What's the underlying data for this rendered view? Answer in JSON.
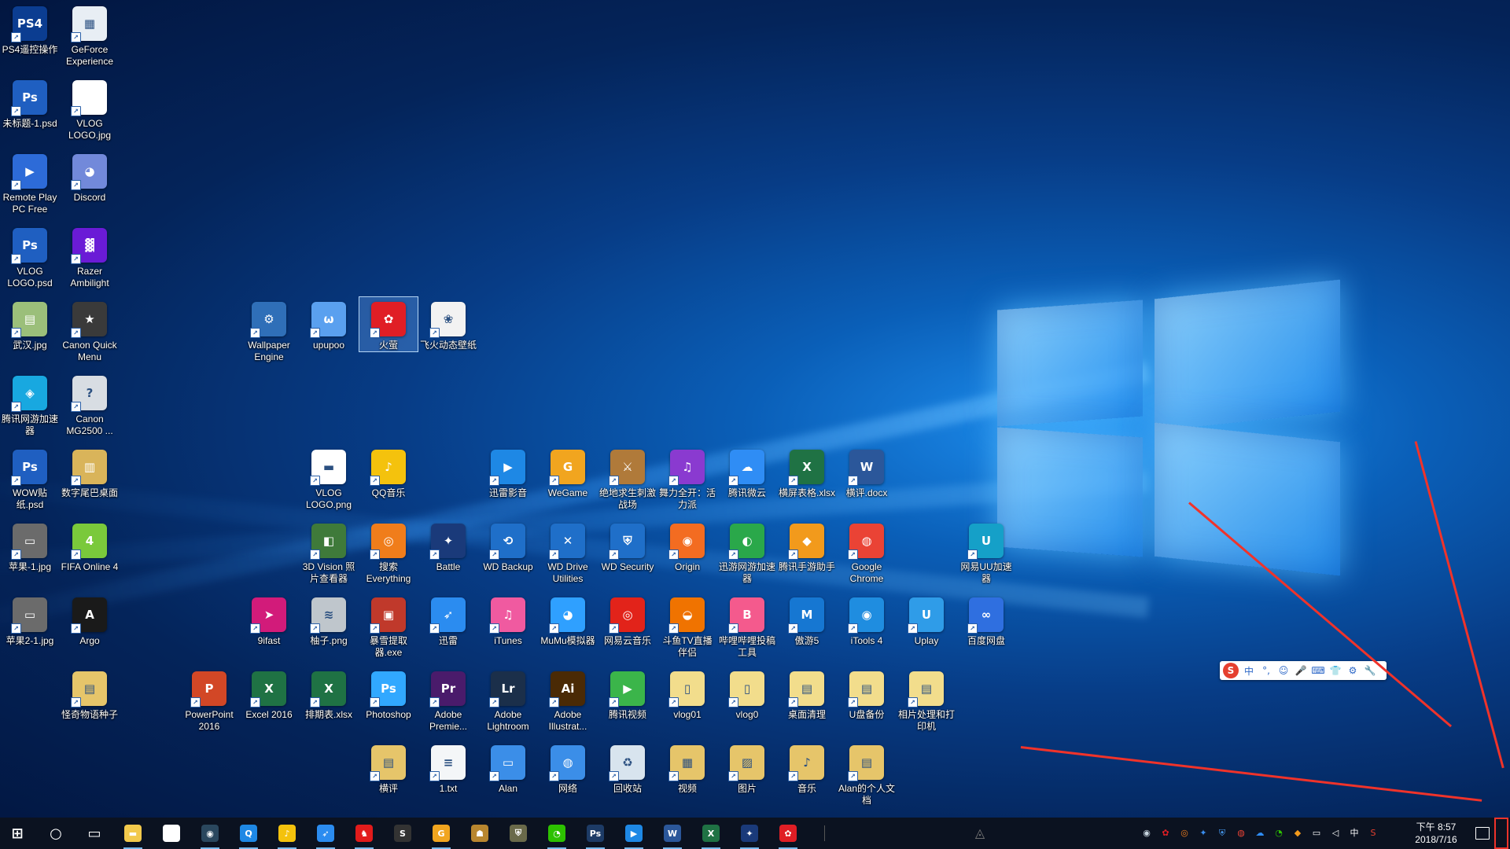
{
  "desktop": {
    "icons": [
      {
        "id": "ps4",
        "label": "PS4遥控操作",
        "glyph": "PS4",
        "color": "#0b3d91",
        "col": 0,
        "row": 0
      },
      {
        "id": "geforce",
        "label": "GeForce Experience",
        "glyph": "▦",
        "color": "#e8eef4",
        "col": 1,
        "row": 0
      },
      {
        "id": "untitled-psd",
        "label": "未标题-1.psd",
        "glyph": "Ps",
        "color": "#1f5fc1",
        "col": 0,
        "row": 1
      },
      {
        "id": "vlog-logo-jpg",
        "label": "VLOG LOGO.jpg",
        "glyph": "",
        "color": "#ffffff",
        "col": 1,
        "row": 1
      },
      {
        "id": "remote-play",
        "label": "Remote Play PC Free",
        "glyph": "▶",
        "color": "#2d6bd8",
        "col": 0,
        "row": 2
      },
      {
        "id": "discord",
        "label": "Discord",
        "glyph": "◕",
        "color": "#7289da",
        "col": 1,
        "row": 2
      },
      {
        "id": "vlog-logo-psd",
        "label": "VLOG LOGO.psd",
        "glyph": "Ps",
        "color": "#1f5fc1",
        "col": 0,
        "row": 3
      },
      {
        "id": "razer",
        "label": "Razer Ambilight",
        "glyph": "▓",
        "color": "#6a1bd6",
        "col": 1,
        "row": 3
      },
      {
        "id": "wuhan",
        "label": "武汉.jpg",
        "glyph": "▤",
        "color": "#9bbf7a",
        "col": 0,
        "row": 4
      },
      {
        "id": "canon-quick",
        "label": "Canon Quick Menu",
        "glyph": "★",
        "color": "#3a3a3a",
        "col": 1,
        "row": 4
      },
      {
        "id": "tencent-acc",
        "label": "腾讯网游加速器",
        "glyph": "◈",
        "color": "#18a8e0",
        "col": 0,
        "row": 5
      },
      {
        "id": "canon-mg",
        "label": "Canon MG2500 ...",
        "glyph": "?",
        "color": "#d8dde3",
        "col": 1,
        "row": 5
      },
      {
        "id": "wow",
        "label": "WOW贴纸.psd",
        "glyph": "Ps",
        "color": "#1f5fc1",
        "col": 0,
        "row": 6
      },
      {
        "id": "numtail",
        "label": "数字尾巴桌面",
        "glyph": "▥",
        "color": "#d9b45a",
        "col": 1,
        "row": 6
      },
      {
        "id": "apple1",
        "label": "苹果-1.jpg",
        "glyph": "▭",
        "color": "#6b6b6b",
        "col": 0,
        "row": 7
      },
      {
        "id": "fifa",
        "label": "FIFA Online 4",
        "glyph": "4",
        "color": "#7ac93b",
        "col": 1,
        "row": 7
      },
      {
        "id": "apple2",
        "label": "苹果2-1.jpg",
        "glyph": "▭",
        "color": "#6b6b6b",
        "col": 0,
        "row": 8
      },
      {
        "id": "argo",
        "label": "Argo",
        "glyph": "A",
        "color": "#1a1a1a",
        "col": 1,
        "row": 8
      },
      {
        "id": "guaiqi",
        "label": "怪奇物语种子",
        "glyph": "▤",
        "color": "#e6c56a",
        "col": 1,
        "row": 9
      },
      {
        "id": "wallpaper-engine",
        "label": "Wallpaper Engine",
        "glyph": "⚙",
        "color": "#2f6fb8",
        "col": 4,
        "row": 4
      },
      {
        "id": "upupoo",
        "label": "upupoo",
        "glyph": "ω",
        "color": "#5aa0ef",
        "col": 5,
        "row": 4
      },
      {
        "id": "huoying",
        "label": "火萤",
        "glyph": "✿",
        "color": "#e01e25",
        "col": 6,
        "row": 4,
        "selected": true
      },
      {
        "id": "feihuo",
        "label": "飞火动态壁纸",
        "glyph": "❀",
        "color": "#f2f2f2",
        "col": 7,
        "row": 4
      },
      {
        "id": "vlog-logo-png",
        "label": "VLOG LOGO.png",
        "glyph": "▬",
        "color": "#ffffff",
        "col": 5,
        "row": 6
      },
      {
        "id": "qqmusic",
        "label": "QQ音乐",
        "glyph": "♪",
        "color": "#f4c20d",
        "col": 6,
        "row": 6
      },
      {
        "id": "xunlei-yy",
        "label": "迅雷影音",
        "glyph": "▶",
        "color": "#1e88e5",
        "col": 8,
        "row": 6
      },
      {
        "id": "wegame",
        "label": "WeGame",
        "glyph": "G",
        "color": "#f1a51f",
        "col": 9,
        "row": 6
      },
      {
        "id": "pubg",
        "label": "绝地求生刺激战场",
        "glyph": "⚔",
        "color": "#b07a3a",
        "col": 10,
        "row": 6
      },
      {
        "id": "wulitq",
        "label": "舞力全开：活力派",
        "glyph": "♫",
        "color": "#8a3ad0",
        "col": 11,
        "row": 6
      },
      {
        "id": "txwy",
        "label": "腾讯微云",
        "glyph": "☁",
        "color": "#2f8df5",
        "col": 12,
        "row": 6
      },
      {
        "id": "hengping-xlsx",
        "label": "横屏表格.xlsx",
        "glyph": "X",
        "color": "#1f7244",
        "col": 13,
        "row": 6
      },
      {
        "id": "hengping-docx",
        "label": "横评.docx",
        "glyph": "W",
        "color": "#2b579a",
        "col": 14,
        "row": 6
      },
      {
        "id": "3dvision",
        "label": "3D Vision 照片查看器",
        "glyph": "◧",
        "color": "#3f7a3a",
        "col": 5,
        "row": 7
      },
      {
        "id": "everything",
        "label": "搜索 Everything",
        "glyph": "◎",
        "color": "#f07d1b",
        "col": 6,
        "row": 7
      },
      {
        "id": "battle",
        "label": "Battle",
        "glyph": "✦",
        "color": "#1a3a7a",
        "col": 7,
        "row": 7
      },
      {
        "id": "wdbackup",
        "label": "WD Backup",
        "glyph": "⟲",
        "color": "#1f6fc9",
        "col": 8,
        "row": 7
      },
      {
        "id": "wddrive",
        "label": "WD Drive Utilities",
        "glyph": "✕",
        "color": "#1f6fc9",
        "col": 9,
        "row": 7
      },
      {
        "id": "wdsecurity",
        "label": "WD Security",
        "glyph": "⛨",
        "color": "#1f6fc9",
        "col": 10,
        "row": 7
      },
      {
        "id": "origin",
        "label": "Origin",
        "glyph": "◉",
        "color": "#f36c21",
        "col": 11,
        "row": 7
      },
      {
        "id": "xunyou",
        "label": "迅游网游加速器",
        "glyph": "◐",
        "color": "#2aa84a",
        "col": 12,
        "row": 7
      },
      {
        "id": "txsy",
        "label": "腾讯手游助手",
        "glyph": "◆",
        "color": "#f29a1c",
        "col": 13,
        "row": 7
      },
      {
        "id": "chrome",
        "label": "Google Chrome",
        "glyph": "◍",
        "color": "#ea4335",
        "col": 14,
        "row": 7
      },
      {
        "id": "wyuu",
        "label": "网易UU加速器",
        "glyph": "U",
        "color": "#15a0c8",
        "col": 16,
        "row": 7
      },
      {
        "id": "9ifast",
        "label": "9ifast",
        "glyph": "➤",
        "color": "#d21b7a",
        "col": 4,
        "row": 8
      },
      {
        "id": "youzi",
        "label": "柚子.png",
        "glyph": "≋",
        "color": "#bfc6cc",
        "col": 5,
        "row": 8
      },
      {
        "id": "baoxue",
        "label": "暴雪提取器.exe",
        "glyph": "▣",
        "color": "#c0392b",
        "col": 6,
        "row": 8
      },
      {
        "id": "xunlei",
        "label": "迅雷",
        "glyph": "➶",
        "color": "#2b8cf0",
        "col": 7,
        "row": 8
      },
      {
        "id": "itunes",
        "label": "iTunes",
        "glyph": "♫",
        "color": "#f05aa0",
        "col": 8,
        "row": 8
      },
      {
        "id": "mumu",
        "label": "MuMu模拟器",
        "glyph": "◕",
        "color": "#2fa0ff",
        "col": 9,
        "row": 8
      },
      {
        "id": "wyymusic",
        "label": "网易云音乐",
        "glyph": "◎",
        "color": "#e2231a",
        "col": 10,
        "row": 8
      },
      {
        "id": "douyu",
        "label": "斗鱼TV直播伴侣",
        "glyph": "◒",
        "color": "#f07300",
        "col": 11,
        "row": 8
      },
      {
        "id": "bilibili",
        "label": "哔哩哔哩投稿工具",
        "glyph": "B",
        "color": "#f45a8d",
        "col": 12,
        "row": 8
      },
      {
        "id": "aoyou5",
        "label": "傲游5",
        "glyph": "M",
        "color": "#1677d2",
        "col": 13,
        "row": 8
      },
      {
        "id": "itools",
        "label": "iTools 4",
        "glyph": "◉",
        "color": "#1f8de0",
        "col": 14,
        "row": 8
      },
      {
        "id": "uplay",
        "label": "Uplay",
        "glyph": "U",
        "color": "#2f9ce8",
        "col": 15,
        "row": 8
      },
      {
        "id": "baidupan",
        "label": "百度网盘",
        "glyph": "∞",
        "color": "#2f6fe0",
        "col": 16,
        "row": 8
      },
      {
        "id": "ppt",
        "label": "PowerPoint 2016",
        "glyph": "P",
        "color": "#d24726",
        "col": 3,
        "row": 9
      },
      {
        "id": "excel",
        "label": "Excel 2016",
        "glyph": "X",
        "color": "#1f7244",
        "col": 4,
        "row": 9
      },
      {
        "id": "paiqi",
        "label": "排期表.xlsx",
        "glyph": "X",
        "color": "#1f7244",
        "col": 5,
        "row": 9
      },
      {
        "id": "photoshop",
        "label": "Photoshop",
        "glyph": "Ps",
        "color": "#31a8ff",
        "col": 6,
        "row": 9
      },
      {
        "id": "premiere",
        "label": "Adobe Premie...",
        "glyph": "Pr",
        "color": "#4a1b6b",
        "col": 7,
        "row": 9
      },
      {
        "id": "lightroom",
        "label": "Adobe Lightroom",
        "glyph": "Lr",
        "color": "#1b2f4a",
        "col": 8,
        "row": 9
      },
      {
        "id": "illustrator",
        "label": "Adobe Illustrat...",
        "glyph": "Ai",
        "color": "#4a2a05",
        "col": 9,
        "row": 9
      },
      {
        "id": "txvideo",
        "label": "腾讯视频",
        "glyph": "▶",
        "color": "#3bb54a",
        "col": 10,
        "row": 9
      },
      {
        "id": "vlog01",
        "label": "vlog01",
        "glyph": "▯",
        "color": "#f2dd8c",
        "col": 11,
        "row": 9
      },
      {
        "id": "vlog0",
        "label": "vlog0",
        "glyph": "▯",
        "color": "#f2dd8c",
        "col": 12,
        "row": 9
      },
      {
        "id": "zmql",
        "label": "桌面清理",
        "glyph": "▤",
        "color": "#f2dd8c",
        "col": 13,
        "row": 9
      },
      {
        "id": "upan",
        "label": "U盘备份",
        "glyph": "▤",
        "color": "#f2dd8c",
        "col": 14,
        "row": 9
      },
      {
        "id": "xpcl",
        "label": "相片处理和打印机",
        "glyph": "▤",
        "color": "#f2dd8c",
        "col": 15,
        "row": 9
      },
      {
        "id": "hengping",
        "label": "横评",
        "glyph": "▤",
        "color": "#e6c56a",
        "col": 6,
        "row": 10
      },
      {
        "id": "txt",
        "label": "1.txt",
        "glyph": "≡",
        "color": "#f4f6f8",
        "col": 7,
        "row": 10
      },
      {
        "id": "alan",
        "label": "Alan",
        "glyph": "▭",
        "color": "#3b8ee8",
        "col": 8,
        "row": 10
      },
      {
        "id": "network",
        "label": "网络",
        "glyph": "◍",
        "color": "#3b8ee8",
        "col": 9,
        "row": 10
      },
      {
        "id": "recycle",
        "label": "回收站",
        "glyph": "♻",
        "color": "#d8e4ee",
        "col": 10,
        "row": 10
      },
      {
        "id": "videos",
        "label": "视频",
        "glyph": "▦",
        "color": "#e6c56a",
        "col": 11,
        "row": 10
      },
      {
        "id": "pictures",
        "label": "图片",
        "glyph": "▨",
        "color": "#e6c56a",
        "col": 12,
        "row": 10
      },
      {
        "id": "music",
        "label": "音乐",
        "glyph": "♪",
        "color": "#e6c56a",
        "col": 13,
        "row": 10
      },
      {
        "id": "alan-docs",
        "label": "Alan的个人文档",
        "glyph": "▤",
        "color": "#e6c56a",
        "col": 14,
        "row": 10
      }
    ]
  },
  "ime_bar": {
    "items": [
      "S",
      "中",
      "°,",
      "☺",
      "🎤",
      "⌨",
      "👕",
      "⚙",
      "🔧"
    ]
  },
  "taskbar": {
    "apps": [
      {
        "id": "start",
        "glyph": "⊞",
        "color": "#ffffff"
      },
      {
        "id": "search",
        "glyph": "○",
        "color": "#ffffff"
      },
      {
        "id": "task-view",
        "glyph": "▭",
        "color": "#ffffff"
      },
      {
        "id": "file-explorer",
        "glyph": "▬",
        "color": "#f2c94c"
      },
      {
        "id": "store",
        "glyph": "▣",
        "color": "#ffffff"
      },
      {
        "id": "steam",
        "glyph": "◉",
        "color": "#2a475e"
      },
      {
        "id": "qq-browser",
        "glyph": "Q",
        "color": "#1e88e5"
      },
      {
        "id": "qqmusic-tb",
        "glyph": "♪",
        "color": "#f4c20d"
      },
      {
        "id": "xunlei-tb",
        "glyph": "➶",
        "color": "#2b8cf0"
      },
      {
        "id": "qq",
        "glyph": "♞",
        "color": "#e21b1b"
      },
      {
        "id": "sogou",
        "glyph": "S",
        "color": "#333333"
      },
      {
        "id": "wegame-tb",
        "glyph": "G",
        "color": "#f1a51f"
      },
      {
        "id": "game-tb",
        "glyph": "☗",
        "color": "#b8862f"
      },
      {
        "id": "shield-tb",
        "glyph": "⛨",
        "color": "#6a6a4a"
      },
      {
        "id": "wechat-tb",
        "glyph": "◔",
        "color": "#2dc100"
      },
      {
        "id": "ps-tb",
        "glyph": "Ps",
        "color": "#1d3b66"
      },
      {
        "id": "xunlei-yy-tb",
        "glyph": "▶",
        "color": "#1e88e5"
      },
      {
        "id": "word-tb",
        "glyph": "W",
        "color": "#2b579a"
      },
      {
        "id": "excel-tb",
        "glyph": "X",
        "color": "#1f7244"
      },
      {
        "id": "battle-tb",
        "glyph": "✦",
        "color": "#1a3a7a"
      },
      {
        "id": "huoying-tb",
        "glyph": "✿",
        "color": "#e01e25"
      }
    ],
    "tray": [
      {
        "id": "steam-tray",
        "glyph": "◉",
        "color": "#c7d5e0"
      },
      {
        "id": "huoying-tray",
        "glyph": "✿",
        "color": "#e01e25"
      },
      {
        "id": "everything-tray",
        "glyph": "◎",
        "color": "#f07d1b"
      },
      {
        "id": "battle-tray",
        "glyph": "✦",
        "color": "#3a8ef0"
      },
      {
        "id": "security-tray",
        "glyph": "⛨",
        "color": "#4aa3ff"
      },
      {
        "id": "chrome-tray",
        "glyph": "◍",
        "color": "#ea4335"
      },
      {
        "id": "cloud-tray",
        "glyph": "☁",
        "color": "#2f8df5"
      },
      {
        "id": "wechat-tray",
        "glyph": "◔",
        "color": "#2dc100"
      },
      {
        "id": "app-tray",
        "glyph": "◆",
        "color": "#f29a1c"
      },
      {
        "id": "network-tray",
        "glyph": "▭",
        "color": "#ffffff"
      },
      {
        "id": "volume-tray",
        "glyph": "◁",
        "color": "#ffffff"
      },
      {
        "id": "ime-tray",
        "glyph": "中",
        "color": "#ffffff"
      },
      {
        "id": "sogou-tray",
        "glyph": "S",
        "color": "#e5402f"
      }
    ],
    "clock": {
      "time": "下午 8:57",
      "date": "2018/7/16"
    }
  }
}
